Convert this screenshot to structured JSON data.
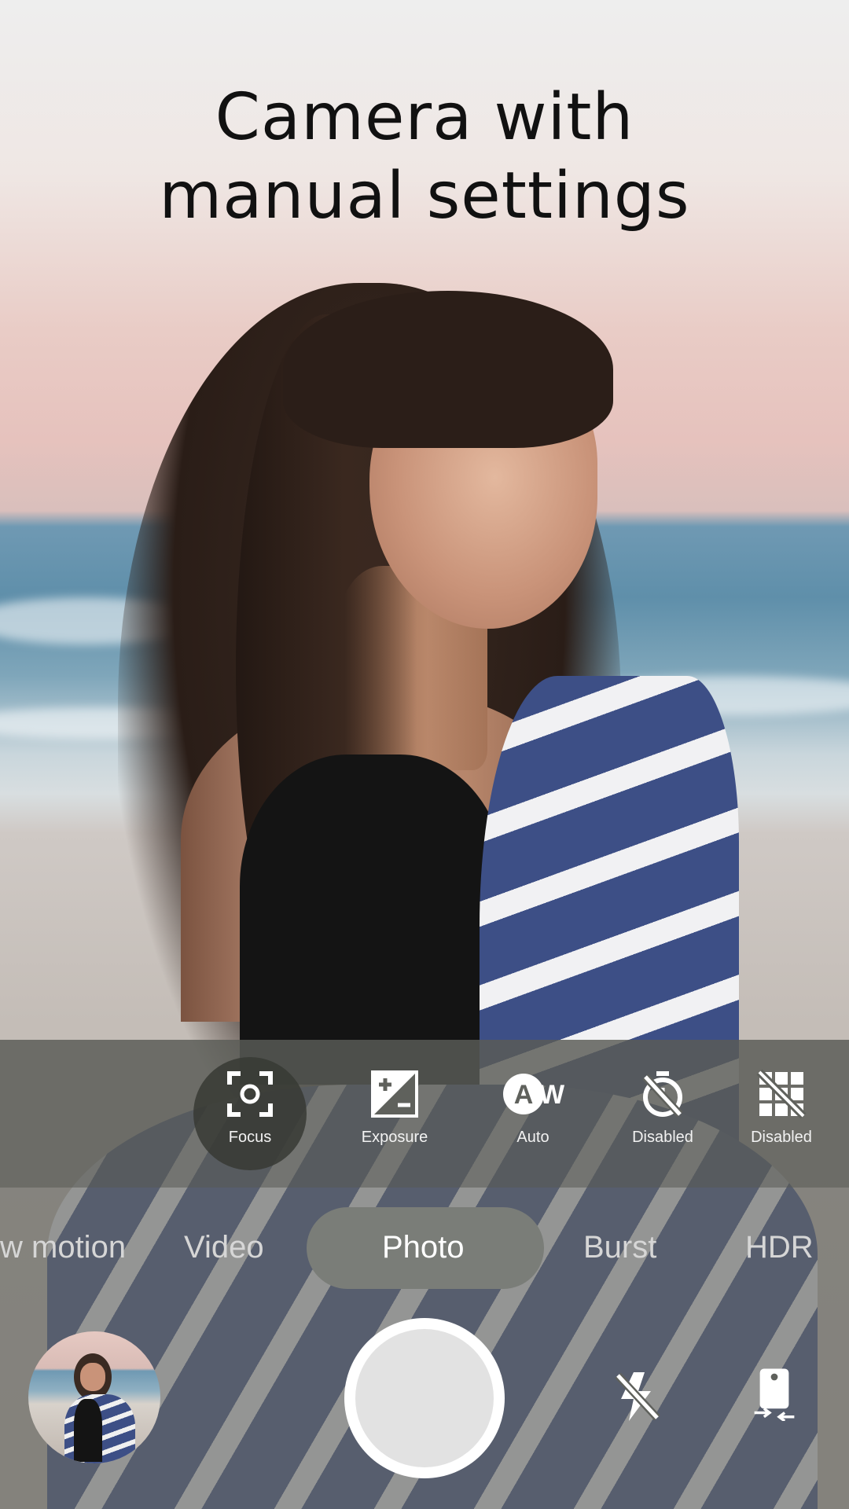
{
  "title": {
    "line1": "Camera with",
    "line2": "manual settings"
  },
  "settings": [
    {
      "label": "Focus",
      "icon": "focus-target-icon",
      "selected": true
    },
    {
      "label": "Exposure",
      "icon": "exposure-plus-minus-icon",
      "selected": false
    },
    {
      "label": "Auto",
      "icon": "white-balance-auto-icon",
      "icon_text": "AW",
      "selected": false
    },
    {
      "label": "Disabled",
      "icon": "timer-off-icon",
      "selected": false
    },
    {
      "label": "Disabled",
      "icon": "grid-off-icon",
      "selected": false
    }
  ],
  "modes": [
    {
      "label": "w motion",
      "active": false
    },
    {
      "label": "Video",
      "active": false
    },
    {
      "label": "Photo",
      "active": true
    },
    {
      "label": "Burst",
      "active": false
    },
    {
      "label": "HDR",
      "active": false
    }
  ],
  "bottom": {
    "gallery_icon": "gallery-thumbnail-icon",
    "shutter_icon": "shutter-icon",
    "flash_icon": "flash-off-icon",
    "switch_icon": "switch-camera-icon"
  },
  "colors": {
    "overlay": "#5f615c",
    "mode_pill": "#7a7d78",
    "shutter_ring": "#ffffff",
    "shutter_fill": "#e2e2e2"
  }
}
